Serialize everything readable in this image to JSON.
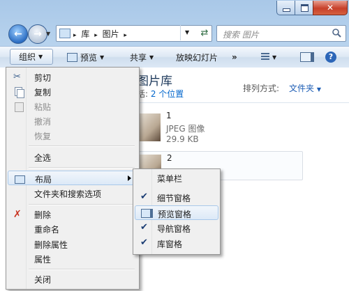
{
  "window": {
    "caption_buttons": {
      "minimize": "—",
      "maximize": "□",
      "close": "✕"
    }
  },
  "address": {
    "breadcrumb_1": "库",
    "breadcrumb_2": "图片",
    "separator": "▸",
    "search_placeholder": "搜索 图片"
  },
  "toolbar": {
    "organize": "组织",
    "preview": "预览",
    "share": "共享",
    "slideshow": "放映幻灯片",
    "more": "»",
    "help": "?"
  },
  "content": {
    "library_title": "图片库",
    "include_label": "括: ",
    "include_link": "2 个位置",
    "sort_label": "排列方式:",
    "sort_value": "文件夹",
    "items": [
      {
        "name": "1",
        "type": "JPEG 图像",
        "size": "29.9 KB"
      },
      {
        "name": "2"
      }
    ]
  },
  "menu": {
    "items": [
      {
        "label": "剪切",
        "icon": "scissors-icon",
        "disabled": false
      },
      {
        "label": "复制",
        "icon": "copy-icon",
        "disabled": false
      },
      {
        "label": "粘贴",
        "icon": "paste-icon",
        "disabled": true
      },
      {
        "label": "撤消",
        "disabled": true
      },
      {
        "label": "恢复",
        "disabled": true
      },
      {
        "label": "全选",
        "disabled": false
      },
      {
        "label": "布局",
        "icon": "layout-icon",
        "submenu": true,
        "highlighted": true
      },
      {
        "label": "文件夹和搜索选项",
        "disabled": false
      },
      {
        "label": "删除",
        "icon": "delete-icon",
        "disabled": false
      },
      {
        "label": "重命名",
        "disabled": false
      },
      {
        "label": "删除属性",
        "disabled": false
      },
      {
        "label": "属性",
        "disabled": false
      },
      {
        "label": "关闭",
        "disabled": false
      }
    ]
  },
  "submenu": {
    "items": [
      {
        "label": "菜单栏",
        "checked": false
      },
      {
        "label": "细节窗格",
        "checked": true
      },
      {
        "label": "预览窗格",
        "checked": false,
        "highlighted": true
      },
      {
        "label": "导航窗格",
        "checked": true
      },
      {
        "label": "库窗格",
        "checked": true
      }
    ],
    "check_glyph": "✔"
  },
  "colors": {
    "accent": "#1e5eb5",
    "title_blue": "#1e395b",
    "highlight_border": "#a8c8ea"
  }
}
